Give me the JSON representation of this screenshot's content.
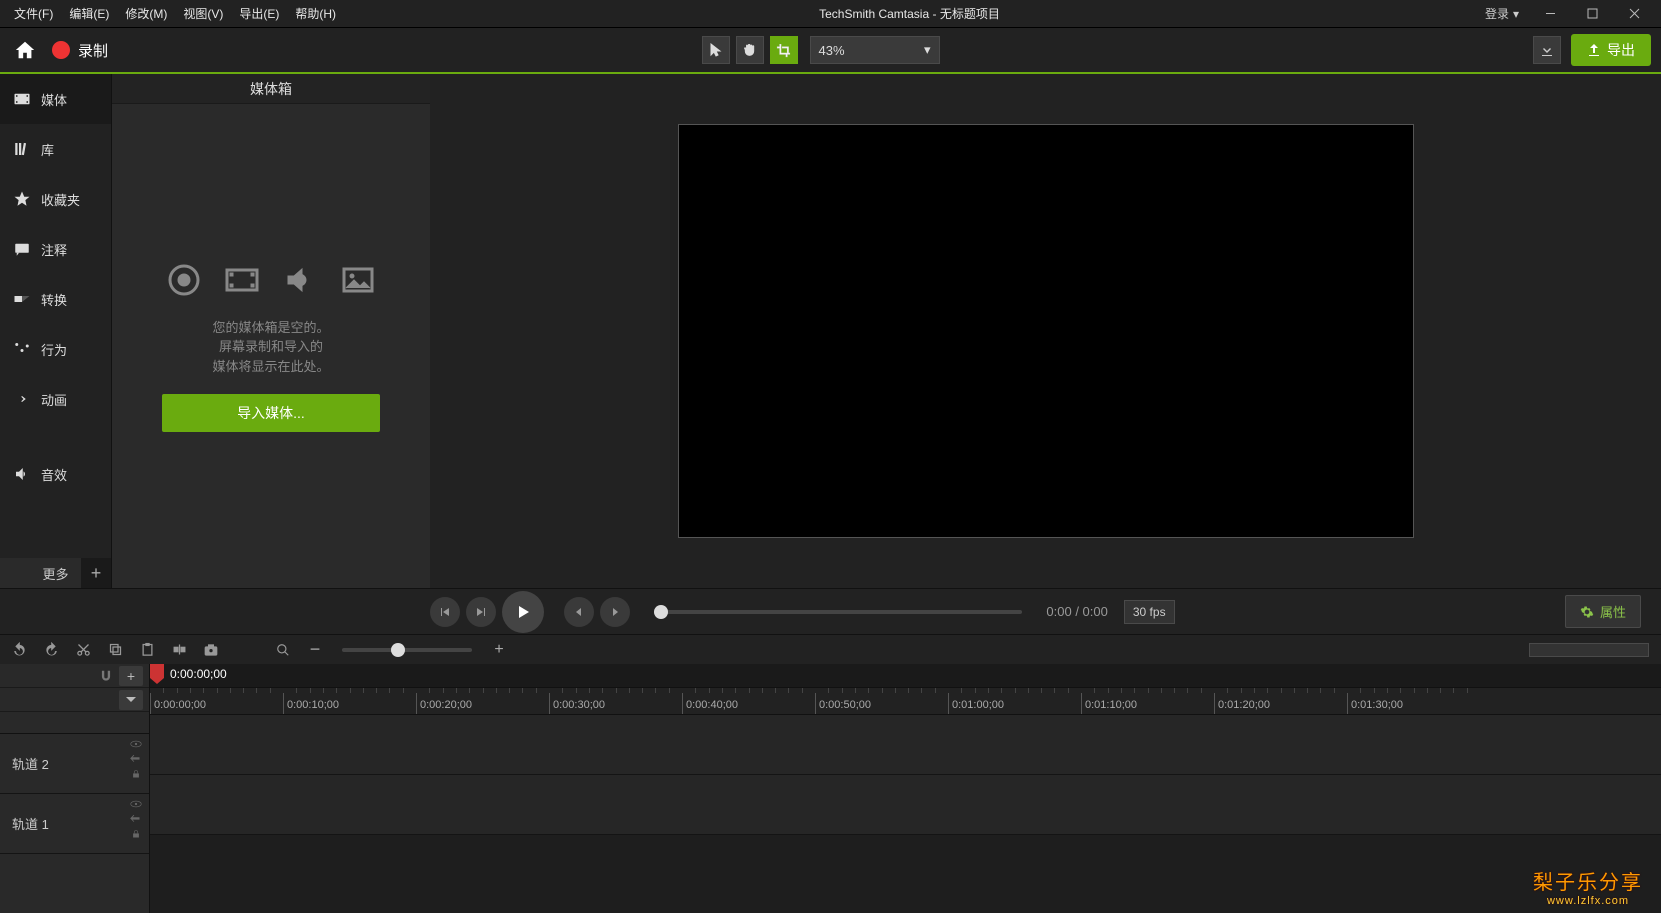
{
  "menubar": {
    "file": "文件(F)",
    "edit": "编辑(E)",
    "modify": "修改(M)",
    "view": "视图(V)",
    "export": "导出(E)",
    "help": "帮助(H)",
    "title": "TechSmith Camtasia - 无标题项目",
    "login": "登录"
  },
  "toolbar": {
    "record_label": "录制",
    "zoom_value": "43%",
    "export_label": "导出"
  },
  "sidebar": {
    "media": "媒体",
    "library": "库",
    "favorites": "收藏夹",
    "annotations": "注释",
    "transitions": "转换",
    "behaviors": "行为",
    "animation": "动画",
    "audio": "音效",
    "more": "更多"
  },
  "panel": {
    "title": "媒体箱",
    "empty_line1": "您的媒体箱是空的。",
    "empty_line2": "屏幕录制和导入的",
    "empty_line3": "媒体将显示在此处。",
    "import_btn": "导入媒体..."
  },
  "playbar": {
    "time": "0:00 / 0:00",
    "fps": "30 fps",
    "properties": "属性"
  },
  "timeline": {
    "playhead_time": "0:00:00;00",
    "ticks": [
      "0:00:00;00",
      "0:00:10;00",
      "0:00:20;00",
      "0:00:30;00",
      "0:00:40;00",
      "0:00:50;00",
      "0:01:00;00",
      "0:01:10;00",
      "0:01:20;00",
      "0:01:30;00"
    ],
    "track2": "轨道 2",
    "track1": "轨道 1"
  },
  "watermark": {
    "l1": "梨子乐分享",
    "l2": "www.lzlfx.com"
  }
}
